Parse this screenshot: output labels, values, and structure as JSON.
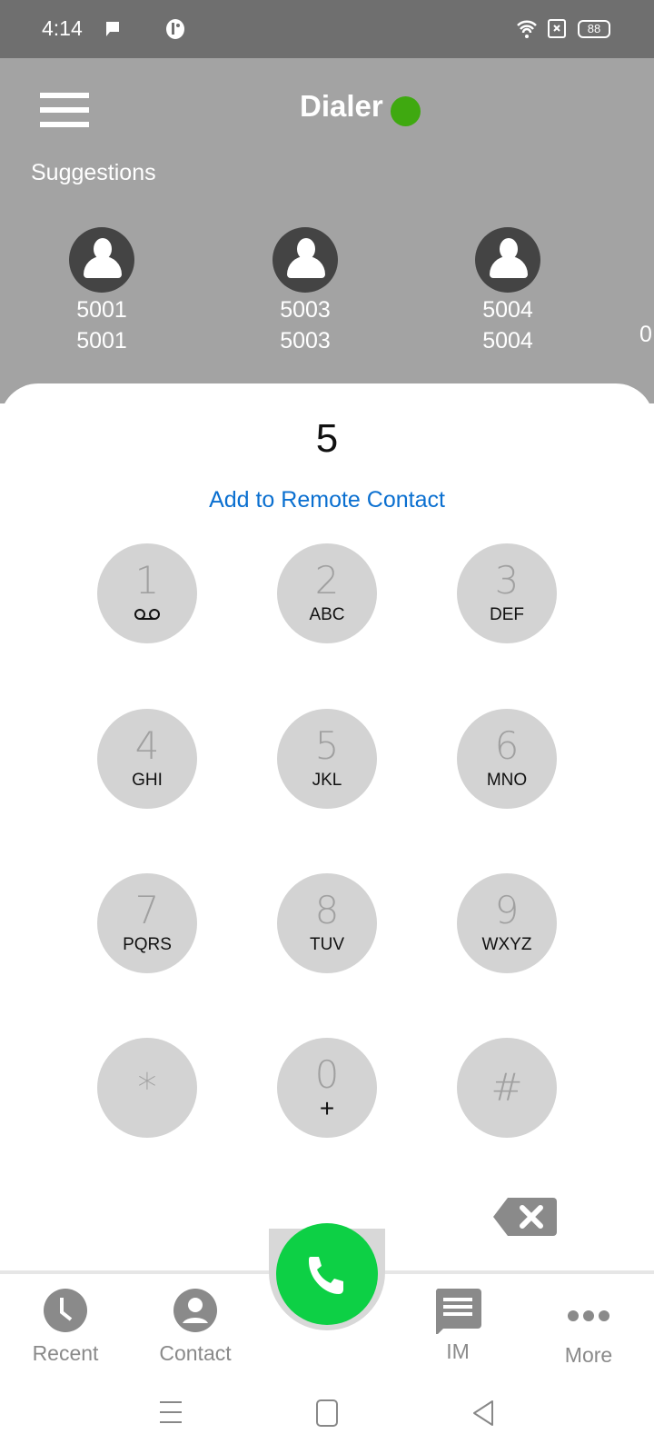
{
  "status": {
    "time": "4:14",
    "battery": "88",
    "icons": [
      "message-icon",
      "app-icon",
      "wifi-icon",
      "sim-off-icon",
      "battery-icon"
    ]
  },
  "header": {
    "title": "Dialer",
    "status_color": "#3fa910",
    "suggestions_label": "Suggestions",
    "suggestions": [
      {
        "name": "5001",
        "number": "5001"
      },
      {
        "name": "5003",
        "number": "5003"
      },
      {
        "name": "5004",
        "number": "5004"
      },
      {
        "name": "",
        "number": "0"
      }
    ]
  },
  "dialer": {
    "input": "5",
    "add_contact": "Add to Remote Contact",
    "keys": [
      {
        "d": "1",
        "l": ""
      },
      {
        "d": "2",
        "l": "ABC"
      },
      {
        "d": "3",
        "l": "DEF"
      },
      {
        "d": "4",
        "l": "GHI"
      },
      {
        "d": "5",
        "l": "JKL"
      },
      {
        "d": "6",
        "l": "MNO"
      },
      {
        "d": "7",
        "l": "PQRS"
      },
      {
        "d": "8",
        "l": "TUV"
      },
      {
        "d": "9",
        "l": "WXYZ"
      },
      {
        "d": "*",
        "l": ""
      },
      {
        "d": "0",
        "l": "+"
      },
      {
        "d": "#",
        "l": ""
      }
    ]
  },
  "nav": {
    "recent": "Recent",
    "contact": "Contact",
    "im": "IM",
    "more": "More"
  },
  "colors": {
    "call": "#0dd045",
    "accent": "#0a6fd0"
  }
}
